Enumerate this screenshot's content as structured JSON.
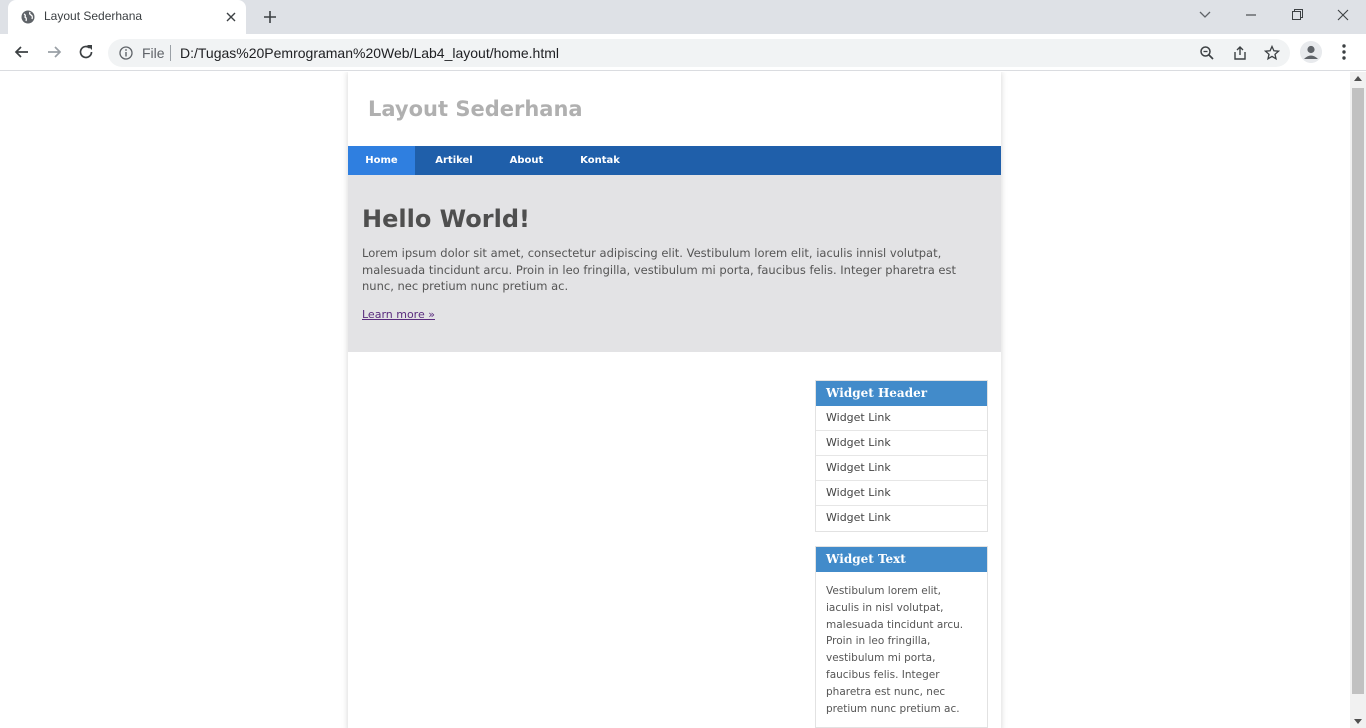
{
  "browser": {
    "tab_title": "Layout Sederhana",
    "scheme_label": "File",
    "url": "D:/Tugas%20Pemrograman%20Web/Lab4_layout/home.html"
  },
  "page": {
    "site_title": "Layout Sederhana",
    "nav": [
      {
        "label": "Home",
        "active": true
      },
      {
        "label": "Artikel",
        "active": false
      },
      {
        "label": "About",
        "active": false
      },
      {
        "label": "Kontak",
        "active": false
      }
    ],
    "hero": {
      "title": "Hello World!",
      "text": "Lorem ipsum dolor sit amet, consectetur adipiscing elit. Vestibulum lorem elit, iaculis innisl volutpat, malesuada tincidunt arcu. Proin in leo fringilla, vestibulum mi porta, faucibus felis. Integer pharetra est nunc, nec pretium nunc pretium ac.",
      "link": "Learn more »"
    },
    "widget_links": {
      "header": "Widget Header",
      "links": [
        "Widget Link",
        "Widget Link",
        "Widget Link",
        "Widget Link",
        "Widget Link"
      ]
    },
    "widget_text": {
      "header": "Widget Text",
      "body": "Vestibulum lorem elit, iaculis in nisl volutpat, malesuada tincidunt arcu. Proin in leo fringilla, vestibulum mi porta, faucibus felis. Integer pharetra est nunc, nec pretium nunc pretium ac."
    }
  },
  "colors": {
    "nav_bg": "#1f5faa",
    "nav_active": "#2f7fe0",
    "hero_bg": "#e3e3e5",
    "widget_header": "#428bca"
  }
}
